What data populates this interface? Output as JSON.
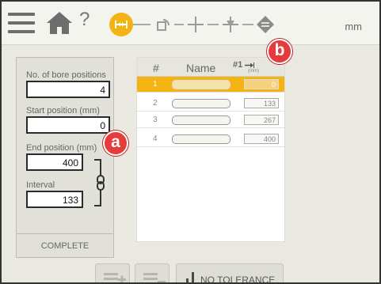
{
  "header": {
    "menu_icon": "hamburger-menu-icon",
    "home_icon": "home-icon",
    "help_label": "?",
    "steps": [
      {
        "icon": "distance-step-icon",
        "active": true
      },
      {
        "icon": "sensor-step-icon",
        "active": false
      },
      {
        "icon": "crosshair-step-icon",
        "active": false
      },
      {
        "icon": "target-step-icon",
        "active": false
      },
      {
        "icon": "result-step-icon",
        "active": false
      }
    ],
    "unit": "mm"
  },
  "settings": {
    "count_label": "No. of bore positions",
    "count_value": "4",
    "start_label": "Start position (mm)",
    "start_value": "0",
    "end_label": "End position (mm)",
    "end_value": "400",
    "interval_label": "Interval",
    "interval_value": "133",
    "link_icon": "chain-link-icon",
    "complete_label": "COMPLETE"
  },
  "table": {
    "col_index": "#",
    "col_name": "Name",
    "col_pos": "#1",
    "col_pos_unit": "(mm)",
    "rows": [
      {
        "idx": "1",
        "value": "0",
        "selected": true
      },
      {
        "idx": "2",
        "value": "133",
        "selected": false
      },
      {
        "idx": "3",
        "value": "267",
        "selected": false
      },
      {
        "idx": "4",
        "value": "400",
        "selected": false
      }
    ]
  },
  "annotations": {
    "a": "a",
    "b": "b"
  },
  "footer": {
    "add_icon": "add-row-icon",
    "remove_icon": "remove-row-icon",
    "tolerance_icon": "tolerance-bars-icon",
    "tolerance_label": "NO TOLERANCE"
  },
  "colors": {
    "accent": "#f3b413",
    "annotation": "#e53b3b"
  }
}
